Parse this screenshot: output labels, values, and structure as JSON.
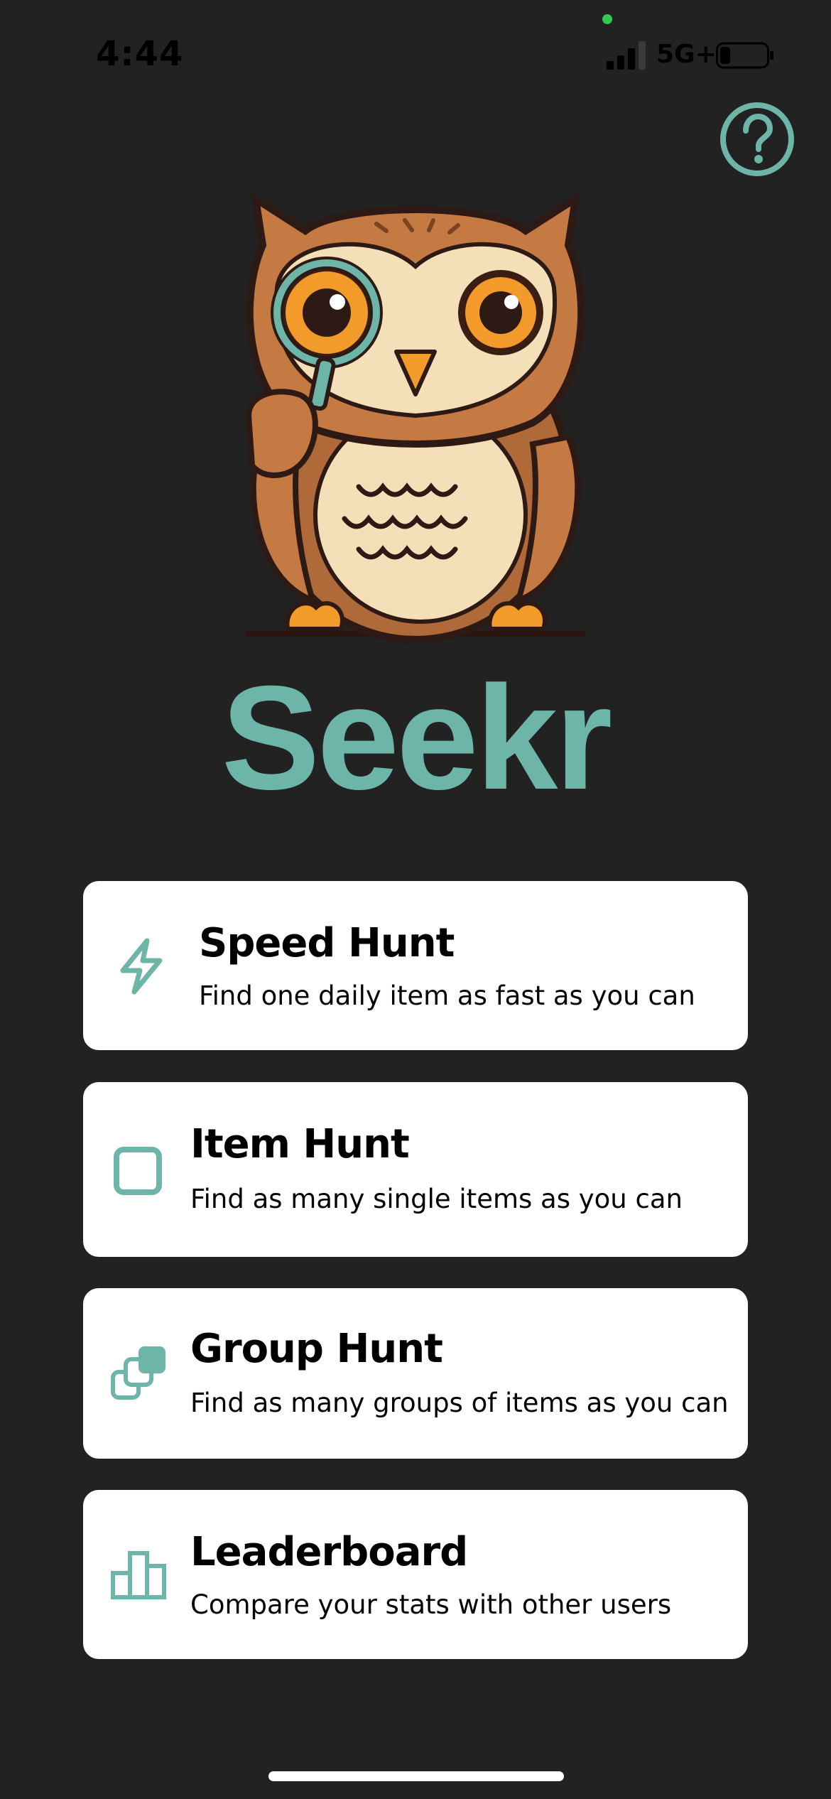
{
  "status_bar": {
    "time": "4:44",
    "network": "5G+"
  },
  "app": {
    "title": "Seekr"
  },
  "colors": {
    "accent": "#6db5a8",
    "background": "#222222",
    "card": "#ffffff"
  },
  "menu": [
    {
      "title": "Speed Hunt",
      "description": "Find one daily item as fast as you can",
      "icon": "lightning-icon"
    },
    {
      "title": "Item Hunt",
      "description": "Find as many single items as you can",
      "icon": "square-icon"
    },
    {
      "title": "Group Hunt",
      "description": "Find as many groups of items as you can",
      "icon": "stacked-squares-icon"
    },
    {
      "title": "Leaderboard",
      "description": "Compare your stats with other users",
      "icon": "bar-chart-icon"
    }
  ]
}
